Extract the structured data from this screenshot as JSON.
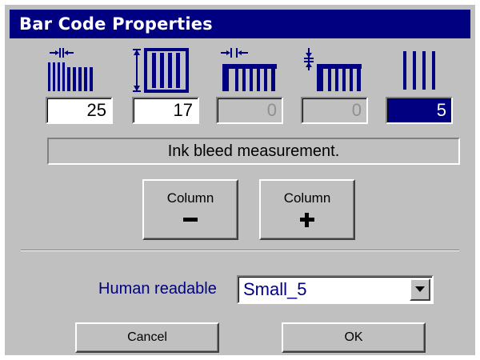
{
  "window": {
    "title": "Bar Code Properties"
  },
  "fields": [
    {
      "value": "25",
      "state": "normal",
      "icon": "narrow-bar-width-icon"
    },
    {
      "value": "17",
      "state": "normal",
      "icon": "bar-height-icon"
    },
    {
      "value": "0",
      "state": "disabled",
      "icon": "wide-bar-width-icon"
    },
    {
      "value": "0",
      "state": "disabled",
      "icon": "bar-height-offset-icon"
    },
    {
      "value": "5",
      "state": "selected",
      "icon": "ink-bleed-icon"
    }
  ],
  "status_text": "Ink bleed measurement.",
  "column_buttons": {
    "minus_label": "Column",
    "plus_label": "Column"
  },
  "human_readable": {
    "label": "Human readable",
    "selected": "Small_5"
  },
  "buttons": {
    "cancel": "Cancel",
    "ok": "OK"
  },
  "colors": {
    "titlebar": "#000080",
    "face": "#c0c0c0",
    "selected_field": "#000080"
  }
}
